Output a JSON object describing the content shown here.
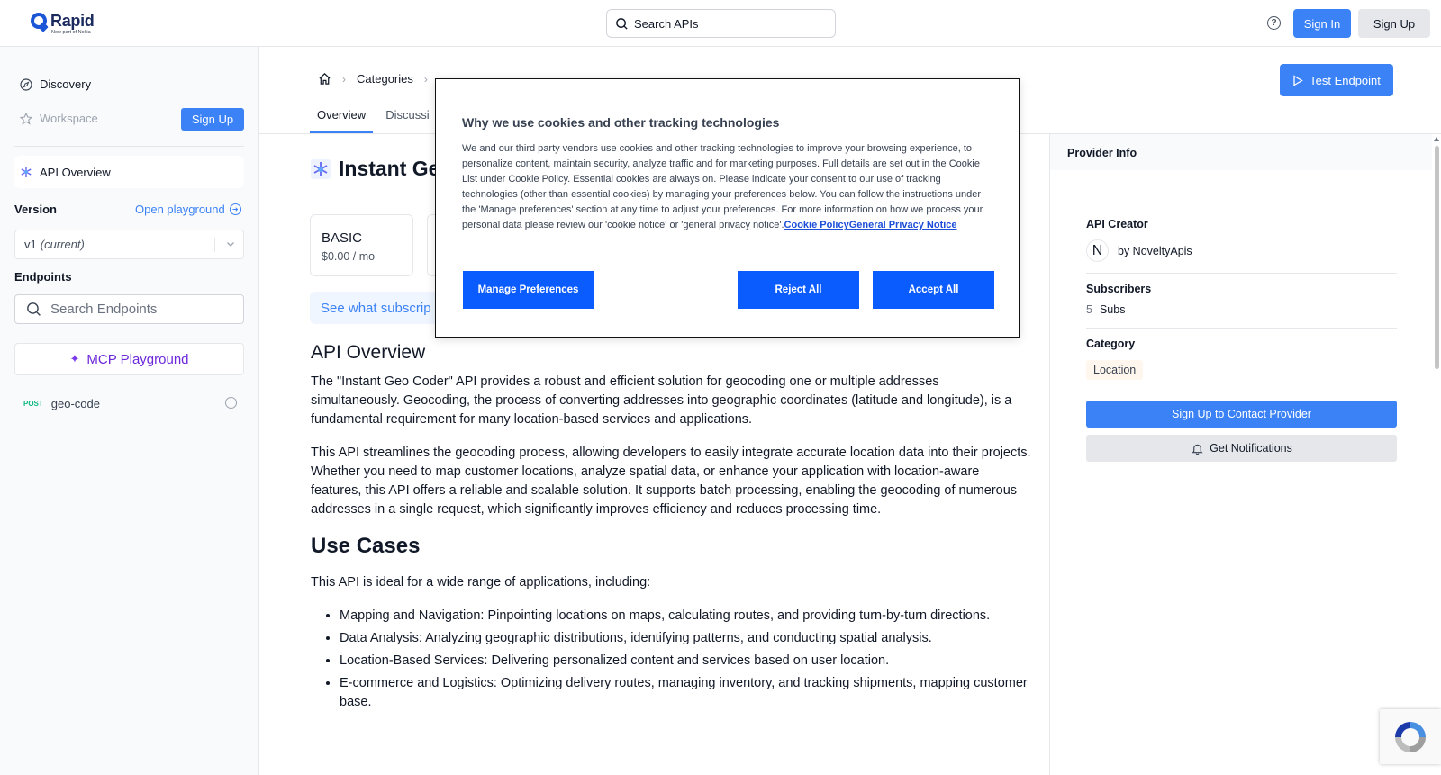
{
  "brand": {
    "name": "Rapid",
    "sub": "Now part of Nokia"
  },
  "topbar": {
    "search_label": "Search APIs",
    "sign_in": "Sign In",
    "sign_up": "Sign Up",
    "help": "?"
  },
  "sidebar": {
    "discovery": "Discovery",
    "workspace": "Workspace",
    "signup": "Sign Up",
    "api_overview": "API Overview",
    "version_label": "Version",
    "open_playground": "Open playground",
    "version_value": "v1",
    "version_current": "(current)",
    "endpoints_label": "Endpoints",
    "endpoints_search_placeholder": "Search Endpoints",
    "mcp_playground": "MCP Playground",
    "endpoints": [
      {
        "method": "POST",
        "name": "geo-code"
      }
    ]
  },
  "breadcrumb": {
    "categories": "Categories"
  },
  "tabs": [
    "Overview",
    "Discussi"
  ],
  "test_endpoint": "Test Endpoint",
  "title": "Instant Ge",
  "plans": [
    {
      "name": "BASIC",
      "price": "$0.00 / mo"
    }
  ],
  "plans_banner": "See what subscrip",
  "overview": {
    "heading": "API Overview",
    "p1": "The \"Instant Geo Coder\" API provides a robust and efficient solution for geocoding one or multiple addresses simultaneously. Geocoding, the process of converting addresses into geographic coordinates (latitude and longitude), is a fundamental requirement for many location-based services and applications.",
    "p2": "This API streamlines the geocoding process, allowing developers to easily integrate accurate location data into their projects. Whether you need to map customer locations, analyze spatial data, or enhance your application with location-aware features, this API offers a reliable and scalable solution. It supports batch processing, enabling the geocoding of numerous addresses in a single request, which significantly improves efficiency and reduces processing time.",
    "use_cases_heading": "Use Cases",
    "use_cases_intro": "This API is ideal for a wide range of applications, including:",
    "use_cases": [
      "Mapping and Navigation: Pinpointing locations on maps, calculating routes, and providing turn-by-turn directions.",
      "Data Analysis: Analyzing geographic distributions, identifying patterns, and conducting spatial analysis.",
      "Location-Based Services: Delivering personalized content and services based on user location.",
      "E-commerce and Logistics: Optimizing delivery routes, managing inventory, and tracking shipments, mapping customer base."
    ]
  },
  "provider": {
    "header": "Provider Info",
    "creator_label": "API Creator",
    "avatar_letter": "N",
    "creator": "by NoveltyApis",
    "subscribers_label": "Subscribers",
    "subs_count": "5",
    "subs_text": "Subs",
    "category_label": "Category",
    "category": "Location",
    "contact_btn": "Sign Up to Contact Provider",
    "notify_btn": "Get Notifications"
  },
  "cookie": {
    "title": "Why we use cookies and other tracking technologies",
    "body": "We and our third party vendors use cookies and other tracking technologies to improve your browsing experience, to personalize content, maintain security, analyze traffic and for marketing purposes. Full details are set out in the Cookie List under Cookie Policy. Essential cookies are always on. Please indicate your consent to our use of tracking technologies (other than essential cookies) by managing your preferences below. You can follow the instructions under the 'Manage preferences' section at any time to adjust your preferences. For more information on how we process your personal data please review our 'cookie notice' or 'general privacy notice'.",
    "link_policy": "Cookie Policy",
    "link_privacy": "General Privacy Notice",
    "manage": "Manage Preferences",
    "reject": "Reject All",
    "accept": "Accept All"
  },
  "colors": {
    "accent": "#3b82f6",
    "cookie_button": "#0b5cff",
    "mcp_purple": "#6d28d9",
    "post_green": "#10b981"
  }
}
